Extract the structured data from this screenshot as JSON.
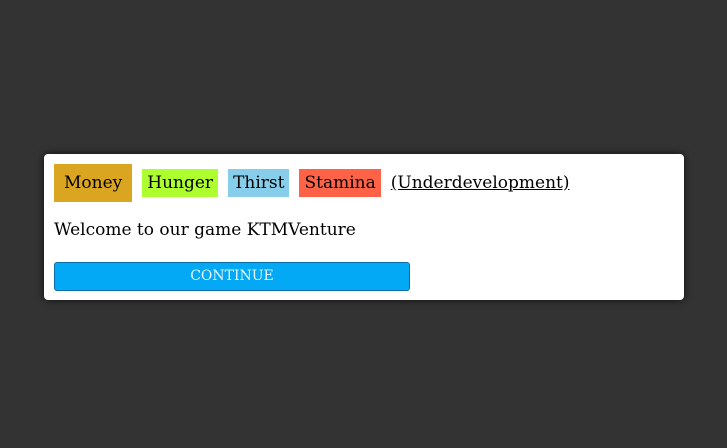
{
  "colors": {
    "background": "#333333",
    "panel": "#ffffff",
    "money": "#daa520",
    "hunger": "#adff2f",
    "thirst": "#87ceeb",
    "stamina": "#ff6347",
    "continue_button": "#03a9f4"
  },
  "stats": {
    "money_label": "Money",
    "hunger_label": "Hunger",
    "thirst_label": "Thirst",
    "stamina_label": "Stamina",
    "dev_link_label": "(Underdevelopment)"
  },
  "dialog": {
    "message": "Welcome to our game KTMVenture",
    "continue_label": "CONTINUE"
  }
}
